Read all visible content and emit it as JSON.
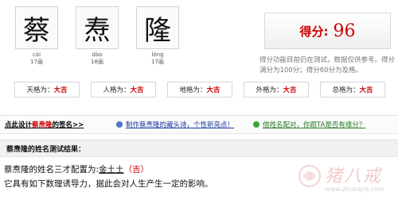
{
  "characters": [
    {
      "char": "蔡",
      "pinyin": "cài",
      "strokes": "17画"
    },
    {
      "char": "焘",
      "pinyin": "dào",
      "strokes": "18画"
    },
    {
      "char": "隆",
      "pinyin": "lóng",
      "strokes": "17画"
    }
  ],
  "score": {
    "label": "得分:",
    "value": "96",
    "note": "得分功能目前仍在测试，数据仅供参考。得分满分为100分；得分60分为及格。"
  },
  "grids": [
    {
      "name": "天格为：",
      "value": "大吉"
    },
    {
      "name": "人格为：",
      "value": "大吉"
    },
    {
      "name": "地格为：",
      "value": "大吉"
    },
    {
      "name": "外格为：",
      "value": "大吉"
    },
    {
      "name": "总格为：",
      "value": "大吉"
    }
  ],
  "links": {
    "design_prefix": "点此设计",
    "design_name": "蔡焘隆",
    "design_suffix": "的签名>>",
    "acrostic": "制作蔡焘隆的藏头诗，个性新亮点！",
    "pairing": "借姓名配对，你跟TA是否有缘分？"
  },
  "section": {
    "title": "蔡焘隆的姓名测试结果："
  },
  "result": {
    "line1_prefix": "蔡焘隆的姓名三才配置为:",
    "sancai": "金土土",
    "jixiong": "（吉）",
    "line2": "它具有如下数理诱导力，据此会对人生产生一定的影响。"
  },
  "watermark": {
    "text": "猪八戒",
    "url": "www.zhubajie.com"
  },
  "colors": {
    "accent_red": "#cc0000",
    "link_blue": "#1a3a9e",
    "link_green": "#2a7a2a"
  }
}
